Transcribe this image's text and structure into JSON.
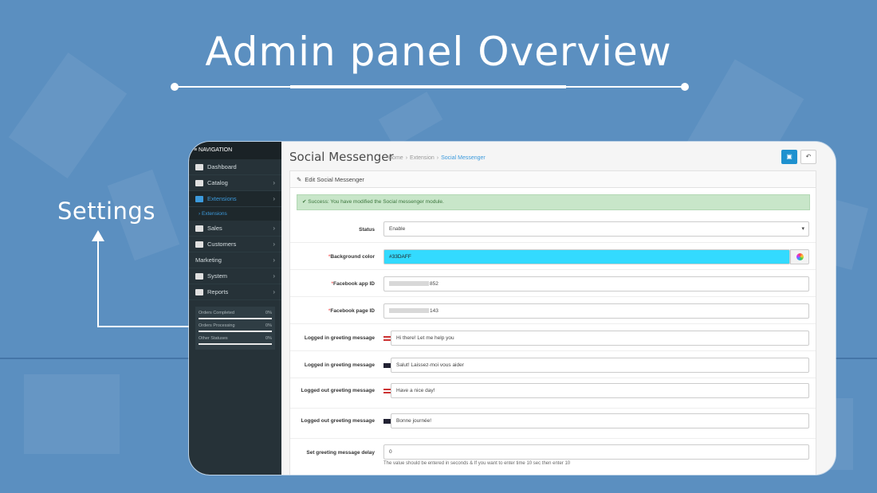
{
  "hero": {
    "title": "Admin panel Overview",
    "callout": "Settings"
  },
  "sidebar": {
    "header": "≡ NAVIGATION",
    "items": [
      {
        "label": "Dashboard",
        "icon": "dashboard-icon"
      },
      {
        "label": "Catalog",
        "icon": "tag-icon"
      },
      {
        "label": "Extensions",
        "icon": "puzzle-icon",
        "active": true
      },
      {
        "label": "Extensions",
        "sub": true
      },
      {
        "label": "Sales",
        "icon": "cart-icon"
      },
      {
        "label": "Customers",
        "icon": "user-icon"
      },
      {
        "label": "Marketing"
      },
      {
        "label": "System",
        "icon": "gear-icon"
      },
      {
        "label": "Reports",
        "icon": "bar-chart-icon"
      }
    ],
    "progress": [
      {
        "label": "Orders Completed",
        "value": "0%"
      },
      {
        "label": "Orders Processing",
        "value": "0%"
      },
      {
        "label": "Other Statuses",
        "value": "0%"
      }
    ]
  },
  "header": {
    "title": "Social Messenger",
    "breadcrumb": [
      "Home",
      "Extension",
      "Social Messenger"
    ],
    "save_icon": "save-icon",
    "back_icon": "reply-icon"
  },
  "panel": {
    "title": "Edit Social Messenger",
    "alert": "Success: You have modified the Social messenger module."
  },
  "form": {
    "status_label": "Status",
    "status_value": "Enable",
    "bg_label": "Background color",
    "bg_value": "#33DAFF",
    "fb_app_label": "Facebook app ID",
    "fb_app_value": "852",
    "fb_page_label": "Facebook page ID",
    "fb_page_value": "143",
    "li_greet_label": "Logged in greeting message",
    "li_greet_en": "Hi there! Let me help you",
    "li_greet_fr": "Salut! Laissez-moi vous aider",
    "lo_greet_label": "Logged out greeting message",
    "lo_greet_en": "Have a nice day!",
    "lo_greet_fr": "Bonne journée!",
    "delay_label": "Set greeting message delay",
    "delay_value": "0",
    "delay_help": "The value should be entered in seconds & If you want to enter time 10 sec then enter 10"
  },
  "colors": {
    "background": "#5b8fc0",
    "sidebar": "#263238",
    "accent": "#1e91cf",
    "color_field": "#33daff",
    "alert": "#c8e6c9"
  }
}
